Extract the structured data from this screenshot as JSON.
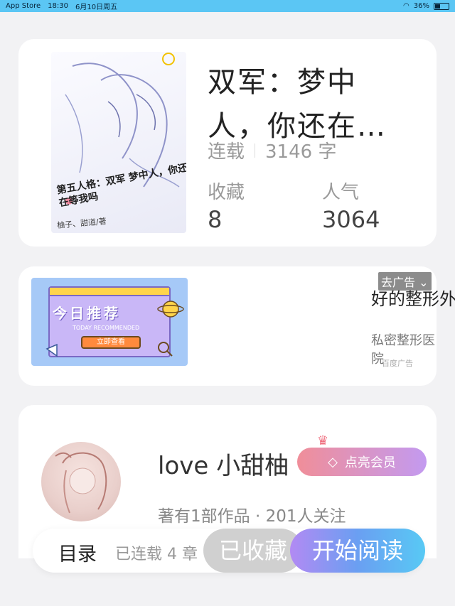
{
  "status_bar": {
    "back_app": "App Store",
    "time": "18:30",
    "date": "6月10日周五",
    "battery": "36%"
  },
  "book": {
    "title": "双军：梦中人，你还在…",
    "cover_title": "第五人格：双军 梦中人，你还在等我吗",
    "cover_author": "柚子、甜道/著",
    "status": "连载",
    "word_count": "3146 字",
    "favorites_label": "收藏",
    "favorites_value": "8",
    "popularity_label": "人气",
    "popularity_value": "3064"
  },
  "ad": {
    "image_heading": "今日推荐",
    "image_sub": "TODAY RECOMMENDED",
    "image_button": "立即查看",
    "badge": "去广告",
    "headline": "好的整形外",
    "brand": "私密整形医院",
    "source": "百度广告"
  },
  "author": {
    "name": "love 小甜柚",
    "vip_label": "点亮会员",
    "meta": "著有1部作品 · 201人关注"
  },
  "bottom_bar": {
    "toc_label": "目录",
    "updated_label": "已连载 4 章",
    "collected_label": "已收藏",
    "start_label": "开始阅读"
  },
  "colors": {
    "status_bar_bg": "#5bc6f4",
    "vip_gradient_start": "#f08e99",
    "vip_gradient_end": "#c39af0",
    "start_gradient_end": "#58c9f4",
    "collected_bg": "#d0d0d0"
  }
}
